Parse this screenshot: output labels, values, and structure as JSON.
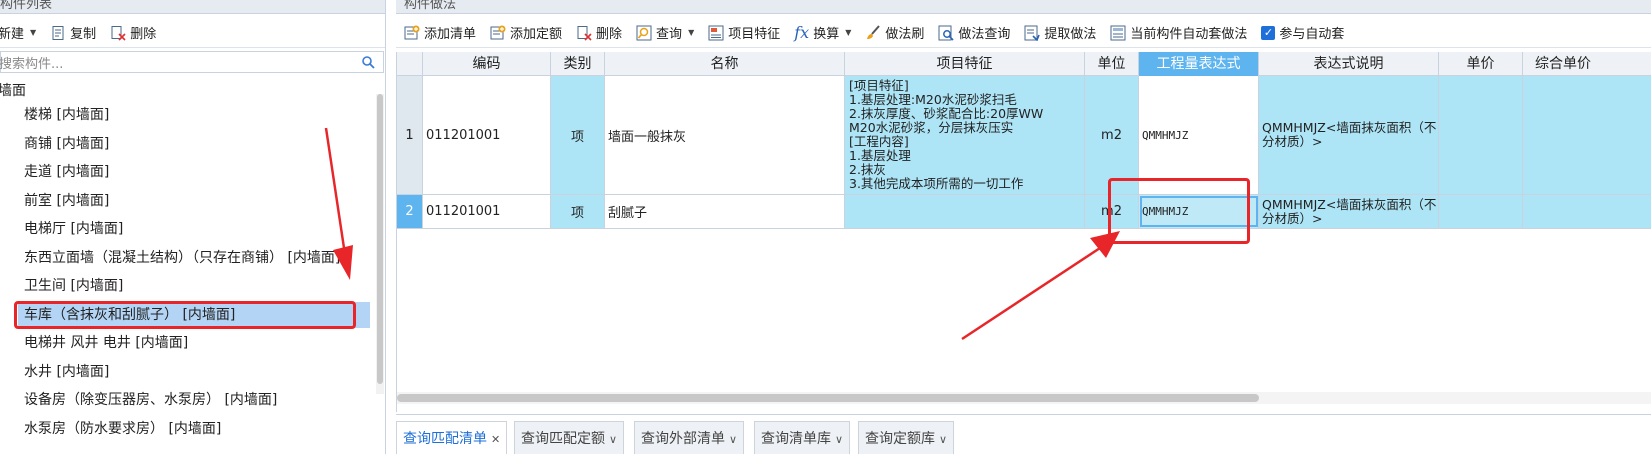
{
  "left_panel": {
    "title": "构件列表",
    "toolbar": {
      "new_label": "新建",
      "copy_label": "复制",
      "delete_label": "删除"
    },
    "search_placeholder": "搜索构件...",
    "tree_root": "墙面",
    "items": [
      "楼梯 [内墙面]",
      "商铺 [内墙面]",
      "走道 [内墙面]",
      "前室 [内墙面]",
      "电梯厅 [内墙面]",
      "东西立面墙（混凝土结构）（只存在商铺） [内墙面]",
      "卫生间 [内墙面]",
      "车库（含抹灰和刮腻子） [内墙面]",
      "电梯井 风井 电井 [内墙面]",
      "水井 [内墙面]",
      "设备房（除变压器房、水泵房） [内墙面]",
      "水泵房（防水要求房） [内墙面]"
    ],
    "selected_index": 7
  },
  "right_panel": {
    "title": "构件做法",
    "toolbar": {
      "add_list": "添加清单",
      "add_quota": "添加定额",
      "delete": "删除",
      "query": "查询",
      "item_feature": "项目特征",
      "convert": "换算",
      "method_brush": "做法刷",
      "method_query": "做法查询",
      "extract_method": "提取做法",
      "auto_apply": "当前构件自动套做法",
      "participate_auto": "参与自动套"
    },
    "columns": [
      "编码",
      "类别",
      "名称",
      "项目特征",
      "单位",
      "工程量表达式",
      "表达式说明",
      "单价",
      "综合单价"
    ],
    "rows": [
      {
        "num": "1",
        "code": "011201001",
        "category": "项",
        "name": "墙面一般抹灰",
        "feature_lines": [
          "[项目特征]",
          "1.基层处理:M20水泥砂浆扫毛",
          "2.抹灰厚度、砂浆配合比:20厚WW",
          "M20水泥砂浆，分层抹灰压实",
          "[工程内容]",
          "1.基层处理",
          "2.抹灰",
          "3.其他完成本项所需的一切工作"
        ],
        "unit": "m2",
        "expression": "QMMHMJZ",
        "description": "QMMHMJZ<墙面抹灰面积（不分材质）>"
      },
      {
        "num": "2",
        "code": "011201001",
        "category": "项",
        "name": "刮腻子",
        "unit": "m2",
        "expression": "QMMHMJZ",
        "description": "QMMHMJZ<墙面抹灰面积（不分材质）>"
      }
    ],
    "bottom_tabs": [
      "查询匹配清单",
      "查询匹配定额",
      "查询外部清单",
      "查询清单库",
      "查询定额库"
    ]
  },
  "colors": {
    "row_highlight": "#ade4f6",
    "active_header": "#5eb4ee",
    "annotation_red": "#e8262a",
    "selection": "#b3d4f4"
  }
}
